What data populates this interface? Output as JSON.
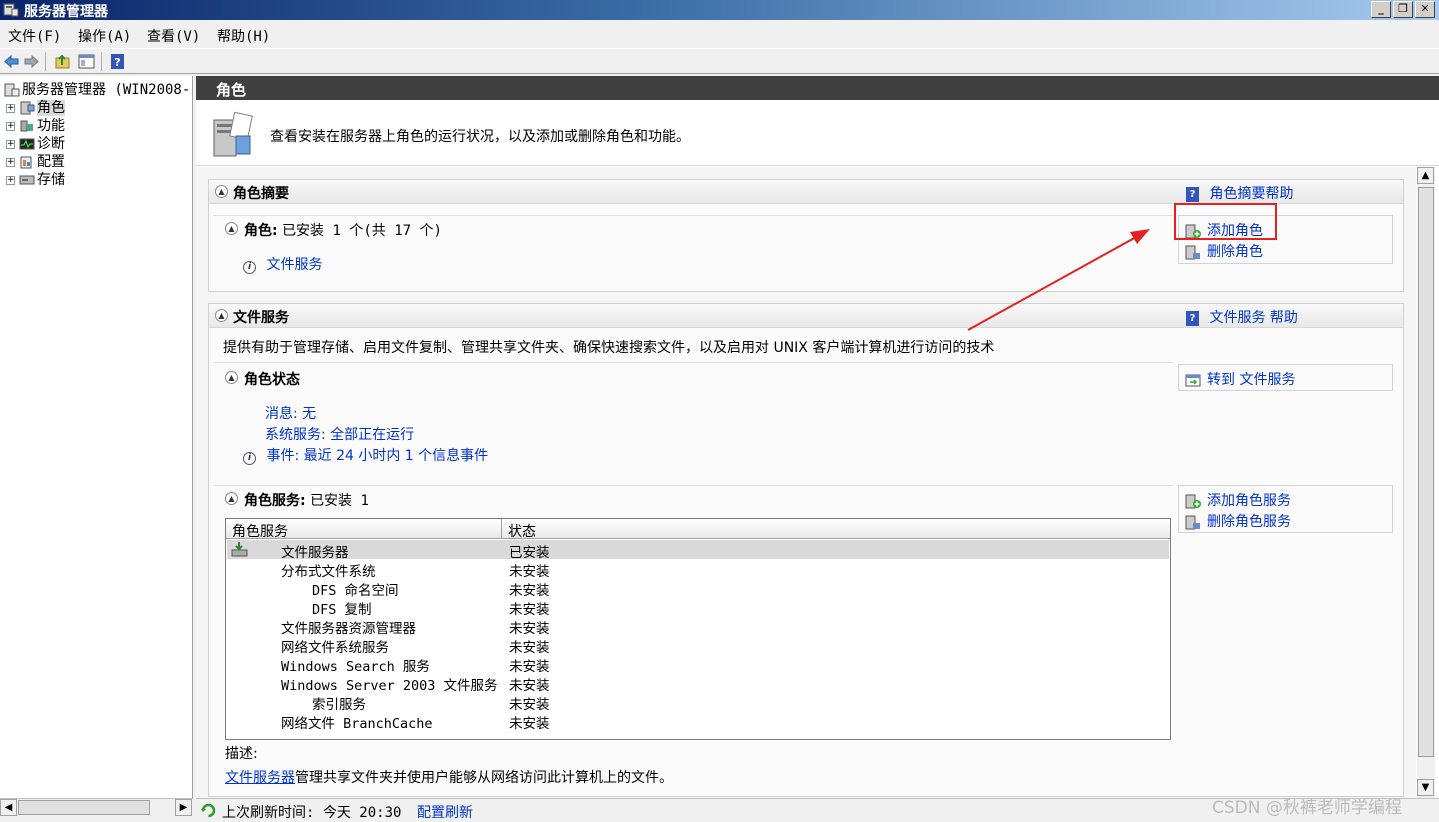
{
  "window": {
    "title": "服务器管理器"
  },
  "menu": [
    "文件(F)",
    "操作(A)",
    "查看(V)",
    "帮助(H)"
  ],
  "tree": {
    "root": "服务器管理器 (WIN2008-",
    "items": [
      {
        "label": "角色",
        "icon": "roles-icon"
      },
      {
        "label": "功能",
        "icon": "features-icon"
      },
      {
        "label": "诊断",
        "icon": "diagnostics-icon"
      },
      {
        "label": "配置",
        "icon": "configuration-icon"
      },
      {
        "label": "存储",
        "icon": "storage-icon"
      }
    ]
  },
  "main": {
    "header": "角色",
    "intro": "查看安装在服务器上角色的运行状况，以及添加或删除角色和功能。",
    "summary": {
      "title": "角色摘要",
      "help": "角色摘要帮助",
      "roles_label": "角色:",
      "roles_value": "已安装 1 个(共 17 个)",
      "role_link": "文件服务",
      "actions": [
        "添加角色",
        "删除角色"
      ]
    },
    "fileservices": {
      "title": "文件服务",
      "help": "文件服务 帮助",
      "description": "提供有助于管理存储、启用文件复制、管理共享文件夹、确保快速搜索文件，以及启用对 UNIX 客户端计算机进行访问的技术",
      "status_title": "角色状态",
      "goto": "转到 文件服务",
      "messages": "消息: 无",
      "system_services": "系统服务: 全部正在运行",
      "events": "事件: 最近 24 小时内 1 个信息事件",
      "services_label": "角色服务:",
      "services_value": "已安装 1",
      "service_actions": [
        "添加角色服务",
        "删除角色服务"
      ],
      "table_headers": [
        "角色服务",
        "状态"
      ],
      "rows": [
        {
          "name": "文件服务器",
          "status": "已安装"
        },
        {
          "name": "分布式文件系统",
          "status": "未安装"
        },
        {
          "name": "DFS 命名空间",
          "status": "未安装"
        },
        {
          "name": "DFS 复制",
          "status": "未安装"
        },
        {
          "name": "文件服务器资源管理器",
          "status": "未安装"
        },
        {
          "name": "网络文件系统服务",
          "status": "未安装"
        },
        {
          "name": "Windows Search 服务",
          "status": "未安装"
        },
        {
          "name": "Windows Server 2003 文件服务",
          "status": "未安装"
        },
        {
          "name": "索引服务",
          "status": "未安装"
        },
        {
          "name": "网络文件 BranchCache",
          "status": "未安装"
        }
      ],
      "desc_label": "描述:",
      "desc_link": "文件服务器",
      "desc_text": "管理共享文件夹并使用户能够从网络访问此计算机上的文件。"
    }
  },
  "status": {
    "last_refresh": "上次刷新时间: 今天 20:30",
    "configure": "配置刷新"
  },
  "watermark": "CSDN @秋裤老师学编程",
  "colors": {
    "accent_link": "#0033cc",
    "annotation": "#e62020",
    "header_bg": "#404040"
  }
}
